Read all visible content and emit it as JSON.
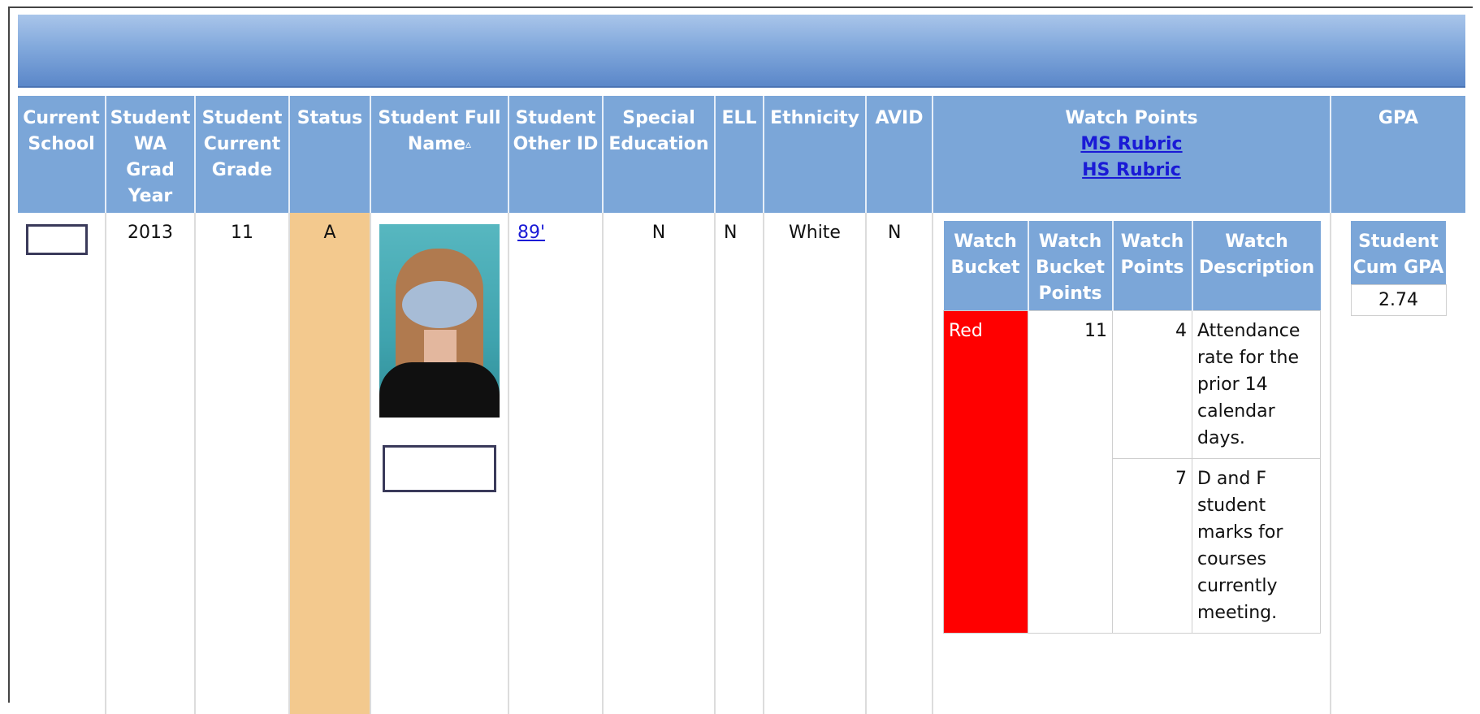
{
  "columns": {
    "current_school": "Current School",
    "grad_year": "Student WA Grad Year",
    "current_grade": "Student Current Grade",
    "status": "Status",
    "full_name": "Student Full Name",
    "sort_glyph": "▵",
    "other_id": "Student Other ID",
    "special_ed": "Special Education",
    "ell": "ELL",
    "ethnicity": "Ethnicity",
    "avid": "AVID",
    "watch_points": "Watch Points",
    "ms_rubric": "MS Rubric",
    "hs_rubric": "HS Rubric",
    "gpa": "GPA"
  },
  "student": {
    "grad_year": "2013",
    "current_grade": "11",
    "status": "A",
    "other_id": "89'",
    "special_ed": "N",
    "ell": "N",
    "ethnicity": "White",
    "avid": "N"
  },
  "watch_table": {
    "headers": [
      "Watch Bucket",
      "Watch Bucket Points",
      "Watch Points",
      "Watch Description"
    ],
    "bucket": "Red",
    "bucket_color": "#ff0000",
    "bucket_points": "11",
    "rows": [
      {
        "points": "4",
        "description": "Attendance rate for the prior 14 calendar days."
      },
      {
        "points": "7",
        "description": "D and F student marks for courses currently meeting."
      }
    ]
  },
  "gpa_table": {
    "header": "Student Cum GPA",
    "value": "2.74"
  },
  "colors": {
    "header_bg": "#7ba6d8",
    "status_bg": "#f3c98e",
    "link": "#1a1ad6"
  }
}
